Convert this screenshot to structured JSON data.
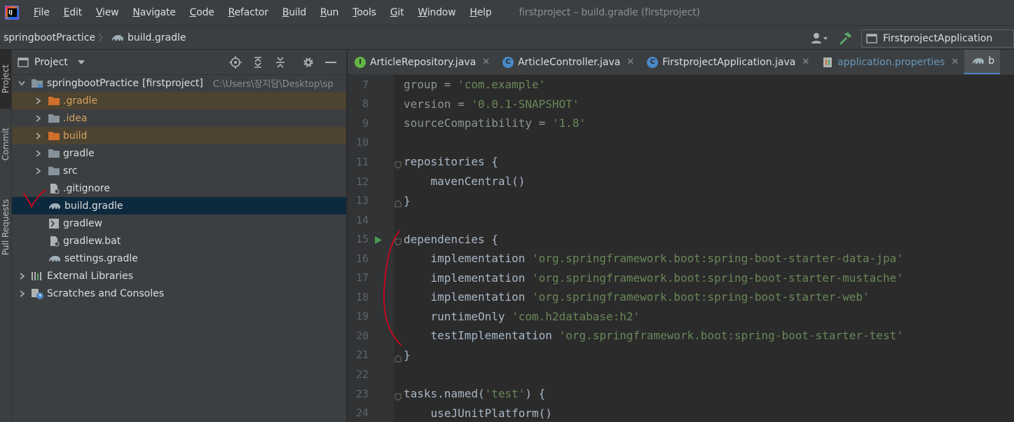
{
  "menubar": {
    "items": [
      {
        "u": "F",
        "rest": "ile"
      },
      {
        "u": "E",
        "rest": "dit"
      },
      {
        "u": "V",
        "rest": "iew"
      },
      {
        "u": "N",
        "rest": "avigate"
      },
      {
        "u": "C",
        "rest": "ode"
      },
      {
        "u": "R",
        "rest": "efactor"
      },
      {
        "u": "B",
        "rest": "uild"
      },
      {
        "u": "R",
        "rest": "un"
      },
      {
        "u": "T",
        "rest": "ools"
      },
      {
        "u": "G",
        "rest": "it"
      },
      {
        "u": "W",
        "rest": "indow"
      },
      {
        "u": "H",
        "rest": "elp"
      }
    ],
    "window_title": "firstproject – build.gradle (firstproject)"
  },
  "navbar": {
    "project": "springbootPractice",
    "file": "build.gradle",
    "run_config": "FirstprojectApplication"
  },
  "left_strip": {
    "project_tab": "Project",
    "commit_tab": "Commit",
    "pull_requests_tab": "Pull Requests"
  },
  "project_panel": {
    "title": "Project",
    "root": {
      "name": "springbootPractice",
      "module": "[firstproject]",
      "path": "C:\\Users\\장지담\\Desktop\\sp"
    },
    "items": [
      {
        "label": ".gradle",
        "type": "folder-excluded"
      },
      {
        "label": ".idea",
        "type": "folder"
      },
      {
        "label": "build",
        "type": "folder-excluded"
      },
      {
        "label": "gradle",
        "type": "folder"
      },
      {
        "label": "src",
        "type": "folder"
      },
      {
        "label": ".gitignore",
        "type": "file"
      },
      {
        "label": "build.gradle",
        "type": "gradle"
      },
      {
        "label": "gradlew",
        "type": "script"
      },
      {
        "label": "gradlew.bat",
        "type": "file"
      },
      {
        "label": "settings.gradle",
        "type": "gradle"
      }
    ],
    "external_libraries": "External Libraries",
    "scratches": "Scratches and Consoles"
  },
  "editor": {
    "tabs": [
      {
        "label": "ArticleRepository.java",
        "icon": "I"
      },
      {
        "label": "ArticleController.java",
        "icon": "C"
      },
      {
        "label": "FirstprojectApplication.java",
        "icon": "C"
      },
      {
        "label": "application.properties",
        "icon": "properties"
      },
      {
        "label": "b",
        "icon": "gradle"
      }
    ],
    "lines": [
      {
        "n": "7",
        "pre": "group = ",
        "str": "'com.example'",
        "post": "",
        "dim": true
      },
      {
        "n": "8",
        "pre": "version = ",
        "str": "'0.0.1-SNAPSHOT'",
        "post": "",
        "dim": true
      },
      {
        "n": "9",
        "pre": "sourceCompatibility = ",
        "str": "'1.8'",
        "post": "",
        "dim": true
      },
      {
        "n": "10",
        "pre": "",
        "str": "",
        "post": ""
      },
      {
        "n": "11",
        "pre": "repositories {",
        "str": "",
        "post": ""
      },
      {
        "n": "12",
        "pre": "    mavenCentral()",
        "str": "",
        "post": ""
      },
      {
        "n": "13",
        "pre": "}",
        "str": "",
        "post": ""
      },
      {
        "n": "14",
        "pre": "",
        "str": "",
        "post": ""
      },
      {
        "n": "15",
        "pre": "dependencies {",
        "str": "",
        "post": ""
      },
      {
        "n": "16",
        "pre": "    implementation ",
        "str": "'org.springframework.boot:spring-boot-starter-data-jpa'",
        "post": ""
      },
      {
        "n": "17",
        "pre": "    implementation ",
        "str": "'org.springframework.boot:spring-boot-starter-mustache'",
        "post": ""
      },
      {
        "n": "18",
        "pre": "    implementation ",
        "str": "'org.springframework.boot:spring-boot-starter-web'",
        "post": ""
      },
      {
        "n": "19",
        "pre": "    runtimeOnly ",
        "str": "'com.h2database:h2'",
        "post": ""
      },
      {
        "n": "20",
        "pre": "    testImplementation ",
        "str": "'org.springframework.boot:spring-boot-starter-test'",
        "post": ""
      },
      {
        "n": "21",
        "pre": "}",
        "str": "",
        "post": ""
      },
      {
        "n": "22",
        "pre": "",
        "str": "",
        "post": ""
      },
      {
        "n": "23",
        "pre": "tasks.named(",
        "str": "'test'",
        "post": ") {"
      },
      {
        "n": "24",
        "pre": "    useJUnitPlatform()",
        "str": "",
        "post": ""
      }
    ]
  },
  "colors": {
    "background": "#2b2b2b",
    "panel": "#3c3f41",
    "selection": "#0d293e",
    "excluded": "#4d4331",
    "string": "#6a8759",
    "annotation_red": "#e0001a"
  }
}
